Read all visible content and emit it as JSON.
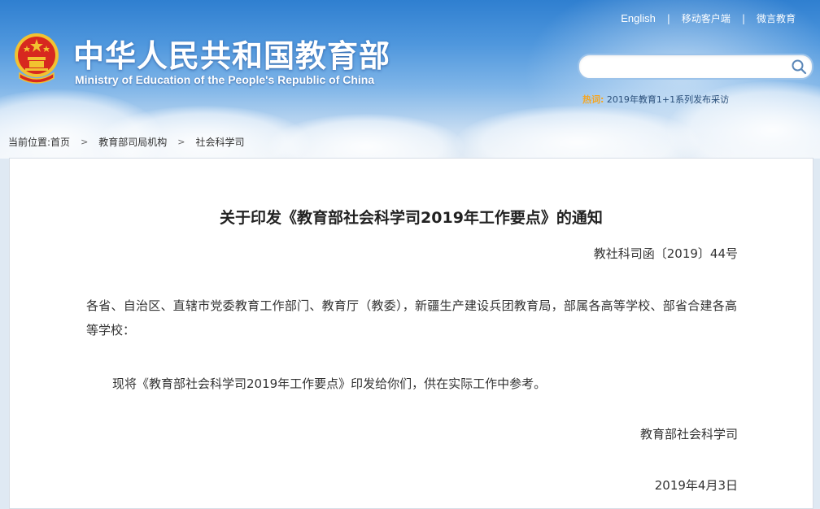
{
  "header": {
    "title_cn": "中华人民共和国教育部",
    "title_en": "Ministry of Education of the People's Republic of China",
    "top_links": [
      "English",
      "移动客户端",
      "微言教育"
    ],
    "search_placeholder": "",
    "hot_label": "热词:",
    "hot_text": "2019年教育1+1系列发布采访"
  },
  "breadcrumb": {
    "label": "当前位置:",
    "items": [
      "首页",
      "教育部司局机构",
      "社会科学司"
    ]
  },
  "document": {
    "title": "关于印发《教育部社会科学司2019年工作要点》的通知",
    "number": "教社科司函〔2019〕44号",
    "paragraph1": "各省、自治区、直辖市党委教育工作部门、教育厅（教委），新疆生产建设兵团教育局，部属各高等学校、部省合建各高等学校：",
    "paragraph2": "现将《教育部社会科学司2019年工作要点》印发给你们，供在实际工作中参考。",
    "signature": "教育部社会科学司",
    "date": "2019年4月3日"
  },
  "colors": {
    "banner_top": "#2f7fd0",
    "banner_bottom": "#e3ecf5",
    "emblem_red": "#d7281f",
    "emblem_gold": "#f2c230",
    "hot_label": "#f5a623"
  },
  "icons": [
    "national-emblem-icon",
    "search-icon",
    "chevron-right-icon"
  ]
}
